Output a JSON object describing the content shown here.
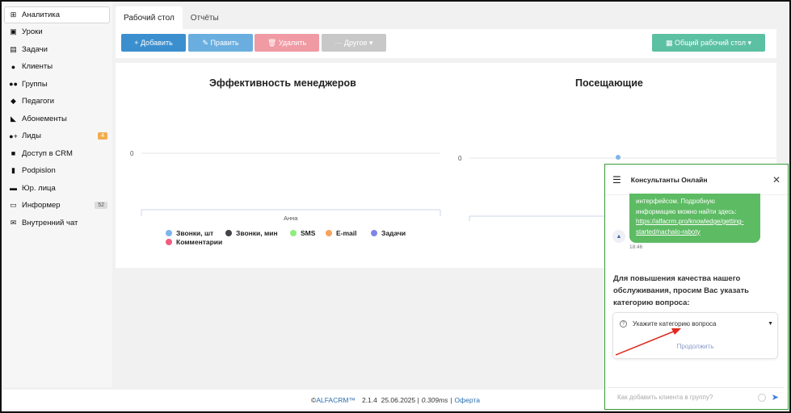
{
  "sidebar": {
    "items": [
      {
        "label": "Аналитика",
        "icon": "map-icon",
        "glyph": "⊞",
        "badge": ""
      },
      {
        "label": "Уроки",
        "icon": "calendar-icon",
        "glyph": "▣",
        "badge": ""
      },
      {
        "label": "Задачи",
        "icon": "clipboard-icon",
        "glyph": "▤",
        "badge": ""
      },
      {
        "label": "Клиенты",
        "icon": "user-icon",
        "glyph": "●",
        "badge": ""
      },
      {
        "label": "Группы",
        "icon": "users-icon",
        "glyph": "●●",
        "badge": ""
      },
      {
        "label": "Педагоги",
        "icon": "graduation-cap-icon",
        "glyph": "◆",
        "badge": ""
      },
      {
        "label": "Абонементы",
        "icon": "tag-icon",
        "glyph": "◣",
        "badge": ""
      },
      {
        "label": "Лиды",
        "icon": "user-plus-icon",
        "glyph": "●+",
        "badge": "4"
      },
      {
        "label": "Доступ в CRM",
        "icon": "lock-icon",
        "glyph": "■",
        "badge": ""
      },
      {
        "label": "Podpislon",
        "icon": "file-icon",
        "glyph": "▮",
        "badge": ""
      },
      {
        "label": "Юр. лица",
        "icon": "briefcase-icon",
        "glyph": "▬",
        "badge": ""
      },
      {
        "label": "Информер",
        "icon": "inbox-icon",
        "glyph": "▭",
        "badge": "52"
      },
      {
        "label": "Внутренний чат",
        "icon": "envelope-icon",
        "glyph": "✉",
        "badge": ""
      }
    ]
  },
  "tabs": [
    {
      "label": "Рабочий стол",
      "active": true
    },
    {
      "label": "Отчёты",
      "active": false
    }
  ],
  "toolbar": {
    "add": "+ Добавить",
    "edit": "✎ Править",
    "delete": "🗑 Удалить",
    "other": "··· Другое ▾",
    "desk": "▦   Общий рабочий стол ▾"
  },
  "charts": {
    "managers_title": "Эффективность менеджеров",
    "managers_zero": "0",
    "managers_xlabel": "Анна",
    "visitors_title": "Посещающие",
    "visitors_zero": "0"
  },
  "chart_data": [
    {
      "type": "bar",
      "title": "Эффективность менеджеров",
      "categories": [
        "Анна"
      ],
      "series": [
        {
          "name": "Звонки, шт",
          "color": "#7cb5ec",
          "values": [
            0
          ]
        },
        {
          "name": "Звонки, мин",
          "color": "#434348",
          "values": [
            0
          ]
        },
        {
          "name": "SMS",
          "color": "#90ed7d",
          "values": [
            0
          ]
        },
        {
          "name": "E-mail",
          "color": "#f7a35c",
          "values": [
            0
          ]
        },
        {
          "name": "Задачи",
          "color": "#8085e9",
          "values": [
            0
          ]
        },
        {
          "name": "Комментарии",
          "color": "#f15c80",
          "values": [
            0
          ]
        }
      ],
      "yticks": [
        "0"
      ]
    },
    {
      "type": "line",
      "title": "Посещающие",
      "series": [
        {
          "values": [
            0
          ]
        }
      ],
      "yticks": [
        "0"
      ]
    }
  ],
  "legend": [
    {
      "label": "Звонки, шт",
      "color": "#7cb5ec"
    },
    {
      "label": "Звонки, мин",
      "color": "#434348"
    },
    {
      "label": "SMS",
      "color": "#90ed7d"
    },
    {
      "label": "E-mail",
      "color": "#f7a35c"
    },
    {
      "label": "Задачи",
      "color": "#8085e9"
    },
    {
      "label": "Комментарии",
      "color": "#f15c80"
    }
  ],
  "footer": {
    "copy": "© ",
    "brand": "ALFACRM™",
    "version": "2.1.4  25.06.2025 |",
    "timing": "0.309ms",
    "sep": "|",
    "offer": "Оферта"
  },
  "chat": {
    "title": "Консультанты Онлайн",
    "bubble_text": "интерфейсом. Подробную информацию можно найти здесь:",
    "bubble_link": "https://alfacrm.pro/knowledge/getting-started/nachalo-raboty",
    "time": "18:46",
    "question": "Для повышения качества нашего обслуживания, просим Вас указать категорию вопроса:",
    "select_placeholder": "Укажите категорию вопроса",
    "continue": "Продолжить",
    "input_placeholder": "Как добавить клиента в группу?"
  }
}
